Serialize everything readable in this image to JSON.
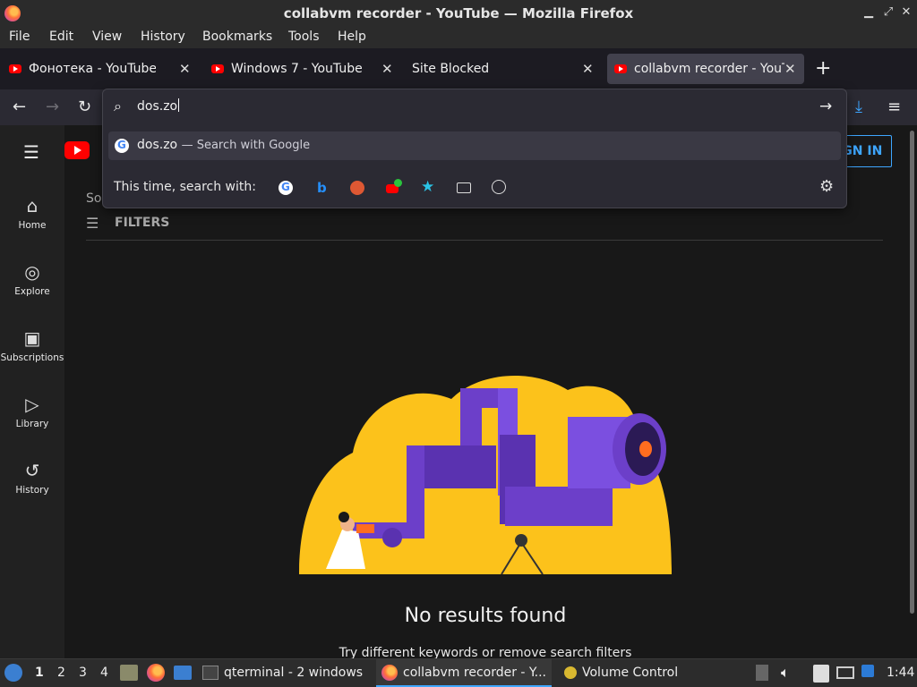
{
  "window": {
    "title": "collabvm recorder - YouTube — Mozilla Firefox"
  },
  "menu": [
    "File",
    "Edit",
    "View",
    "History",
    "Bookmarks",
    "Tools",
    "Help"
  ],
  "tabs": [
    {
      "label": "Фонотека - YouTube Studio",
      "favicon": "youtube",
      "active": false
    },
    {
      "label": "Windows 7 - YouTube",
      "favicon": "youtube",
      "active": false
    },
    {
      "label": "Site Blocked",
      "favicon": "none",
      "active": false
    },
    {
      "label": "collabvm recorder - YouTube",
      "favicon": "youtube",
      "active": true
    }
  ],
  "urlbar": {
    "value": "dos.zo",
    "suggestion": {
      "text": "dos.zo",
      "separator": "—",
      "action": "Search with Google"
    },
    "search_with_label": "This time, search with:",
    "engines": [
      "google-icon",
      "bing-icon",
      "duckduckgo-icon",
      "youtube-plus-icon",
      "bookmarks-star-icon",
      "tabs-icon",
      "history-icon"
    ]
  },
  "youtube": {
    "sign_in": "SIGN IN",
    "sort_label": "Sort",
    "filters": "FILTERS",
    "sidebar": [
      "Home",
      "Explore",
      "Subscriptions",
      "Library",
      "History"
    ],
    "empty_title": "No results found",
    "empty_subtitle": "Try different keywords or remove search filters"
  },
  "taskbar": {
    "workspaces": [
      "1",
      "2",
      "3",
      "4"
    ],
    "items": [
      "qterminal - 2 windows",
      "collabvm recorder - Y...",
      "Volume Control"
    ],
    "clock": "1:44"
  },
  "colors": {
    "accent": "#3ea6ff",
    "youtube_red": "#ff0000",
    "illustration_yellow": "#fcc21b",
    "illustration_purple": "#6c3fc9"
  }
}
